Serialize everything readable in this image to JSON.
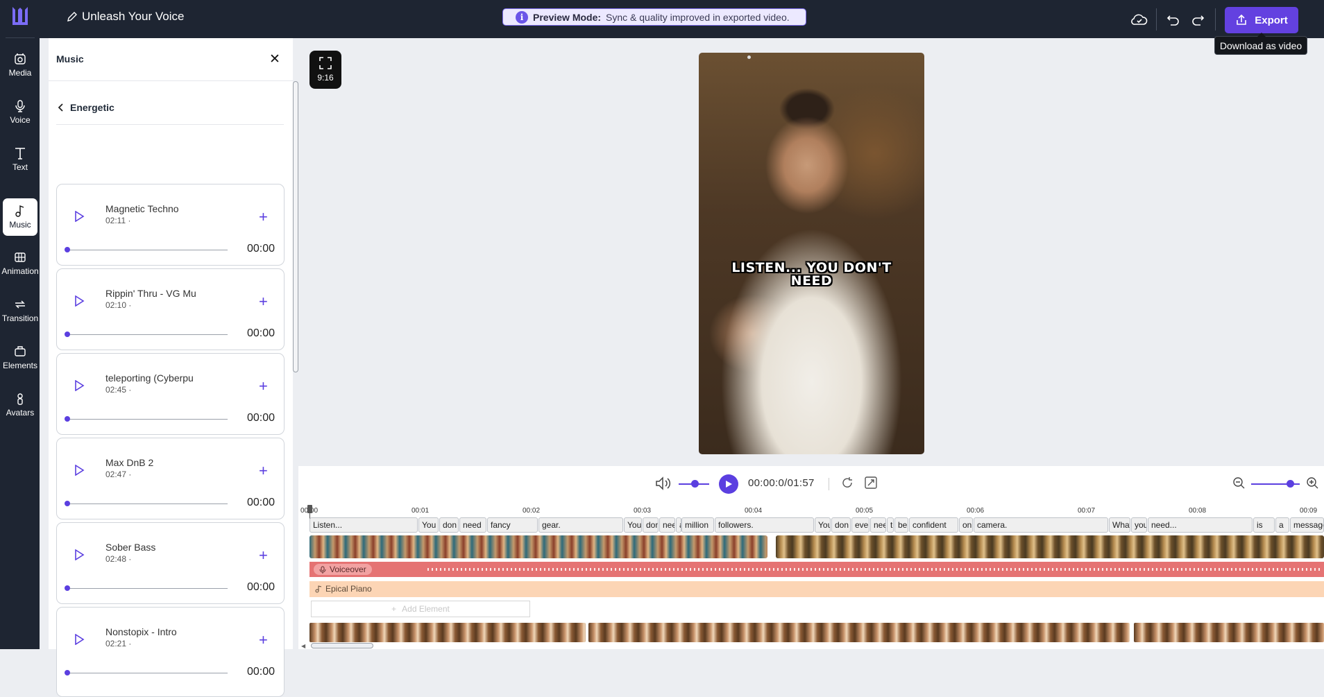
{
  "app": {
    "project_title": "Unleash Your Voice",
    "preview_banner": {
      "bold": "Preview Mode:",
      "text": "Sync & quality improved in exported video."
    },
    "export_label": "Export",
    "export_tooltip": "Download as video",
    "accent_color": "#5b3fe0"
  },
  "rail": [
    {
      "label": "Media",
      "icon": "media-icon"
    },
    {
      "label": "Voice",
      "icon": "microphone-icon"
    },
    {
      "label": "Text",
      "icon": "text-icon"
    },
    {
      "label": "Music",
      "icon": "music-note-icon",
      "active": true
    },
    {
      "label": "Animation",
      "icon": "animation-icon"
    },
    {
      "label": "Transition",
      "icon": "transition-icon"
    },
    {
      "label": "Elements",
      "icon": "elements-icon"
    },
    {
      "label": "Avatars",
      "icon": "avatar-icon"
    }
  ],
  "panel": {
    "title": "Music",
    "category": "Energetic",
    "tracks": [
      {
        "name": "Magnetic Techno",
        "duration": "02:11 ·",
        "time": "00:00"
      },
      {
        "name": "Rippin' Thru - VG Mu",
        "duration": "02:10 ·",
        "time": "00:00"
      },
      {
        "name": "teleporting (Cyberpu",
        "duration": "02:45 ·",
        "time": "00:00"
      },
      {
        "name": "Max DnB 2",
        "duration": "02:47 ·",
        "time": "00:00"
      },
      {
        "name": "Sober Bass",
        "duration": "02:48 ·",
        "time": "00:00"
      },
      {
        "name": "Nonstopix - Intro",
        "duration": "02:21 ·",
        "time": "00:00"
      }
    ]
  },
  "preview": {
    "aspect_ratio": "9:16",
    "caption_line1": "LISTEN... YOU DON'T",
    "caption_line2": "NEED"
  },
  "player": {
    "timecode": "00:00:0/01:57",
    "volume_level": 0.4,
    "zoom_level": 0.75
  },
  "ruler": [
    "00:00",
    "00:01",
    "00:02",
    "00:03",
    "00:04",
    "00:05",
    "00:06",
    "00:07",
    "00:08",
    "00:09"
  ],
  "words": [
    {
      "text": "Listen...",
      "start": 0.0,
      "end": 0.98
    },
    {
      "text": "You",
      "start": 0.98,
      "end": 1.17
    },
    {
      "text": "don",
      "start": 1.17,
      "end": 1.35
    },
    {
      "text": "need",
      "start": 1.35,
      "end": 1.6
    },
    {
      "text": "fancy",
      "start": 1.6,
      "end": 2.06
    },
    {
      "text": "gear.",
      "start": 2.06,
      "end": 2.83
    },
    {
      "text": "You",
      "start": 2.83,
      "end": 3.0
    },
    {
      "text": "don",
      "start": 3.0,
      "end": 3.15
    },
    {
      "text": "need",
      "start": 3.15,
      "end": 3.3
    },
    {
      "text": "a",
      "start": 3.3,
      "end": 3.35
    },
    {
      "text": "million",
      "start": 3.35,
      "end": 3.65
    },
    {
      "text": "followers.",
      "start": 3.65,
      "end": 4.55
    },
    {
      "text": "You",
      "start": 4.55,
      "end": 4.7
    },
    {
      "text": "don",
      "start": 4.7,
      "end": 4.88
    },
    {
      "text": "eve",
      "start": 4.88,
      "end": 5.05
    },
    {
      "text": "nee",
      "start": 5.05,
      "end": 5.2
    },
    {
      "text": "to",
      "start": 5.2,
      "end": 5.27
    },
    {
      "text": "be",
      "start": 5.27,
      "end": 5.4
    },
    {
      "text": "confident",
      "start": 5.4,
      "end": 5.85
    },
    {
      "text": "on",
      "start": 5.85,
      "end": 5.98
    },
    {
      "text": "camera.",
      "start": 5.98,
      "end": 7.2
    },
    {
      "text": "What",
      "start": 7.2,
      "end": 7.4
    },
    {
      "text": "you",
      "start": 7.4,
      "end": 7.55
    },
    {
      "text": "need...",
      "start": 7.55,
      "end": 8.5
    },
    {
      "text": "is",
      "start": 8.5,
      "end": 8.7
    },
    {
      "text": "a",
      "start": 8.7,
      "end": 8.83
    },
    {
      "text": "message",
      "start": 8.83,
      "end": 9.3
    }
  ],
  "tracks": {
    "voiceover_label": "Voiceover",
    "music_label": "Epical Piano",
    "add_element_label": "Add Element"
  }
}
